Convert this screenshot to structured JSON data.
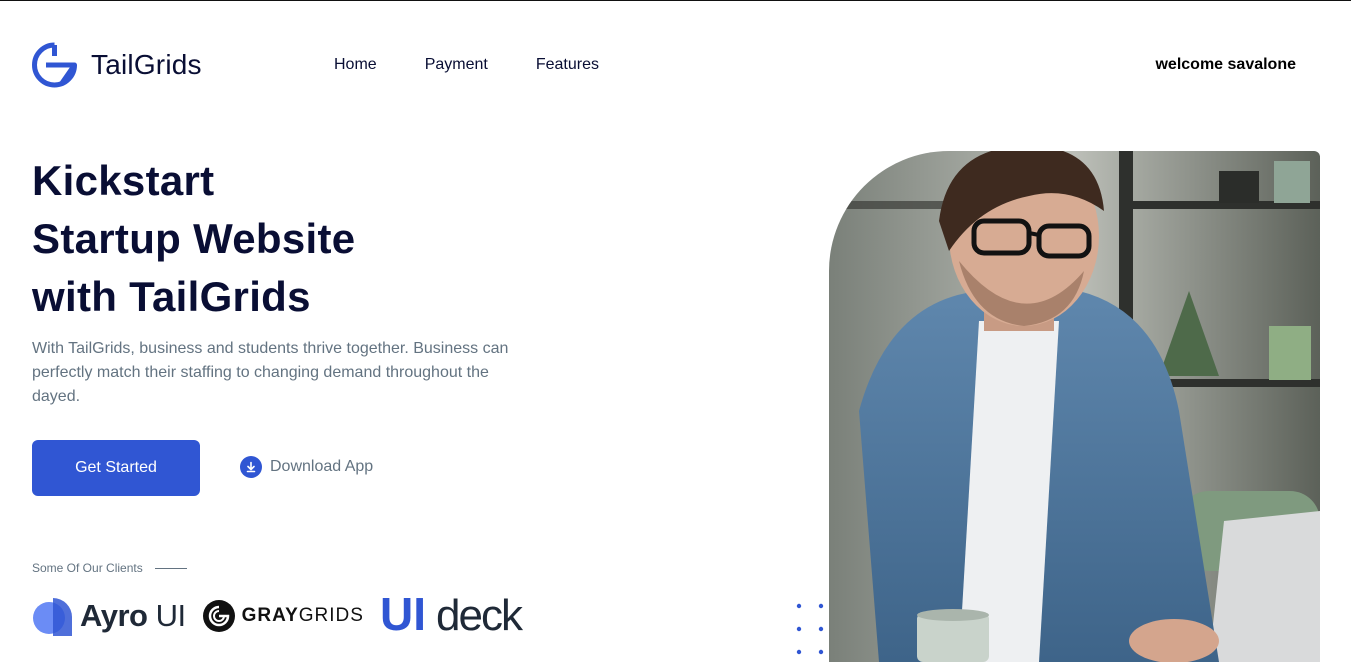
{
  "header": {
    "logo_text": "TailGrids",
    "nav": [
      "Home",
      "Payment",
      "Features"
    ],
    "welcome": "welcome savalone"
  },
  "hero": {
    "title_lines": [
      "Kickstart",
      "Startup Website",
      "with TailGrids"
    ],
    "description": "With TailGrids, business and students thrive together. Business can perfectly match their staffing to changing demand throughout the dayed.",
    "primary_button": "Get Started",
    "secondary_link": "Download App",
    "secondary_icon": "download-icon",
    "image_alt": "man-with-glasses-working-on-laptop"
  },
  "clients": {
    "label": "Some Of Our Clients",
    "logos": [
      {
        "name": "Ayro UI",
        "bold": "Ayro",
        "light": "UI"
      },
      {
        "name": "GRAYGRIDS",
        "bold": "GRAY",
        "light": "GRIDS"
      },
      {
        "name": "UIdeck",
        "bold": "UI",
        "light": "deck"
      }
    ]
  },
  "colors": {
    "primary": "#3056d3",
    "heading": "#090e34",
    "body": "#637381"
  }
}
